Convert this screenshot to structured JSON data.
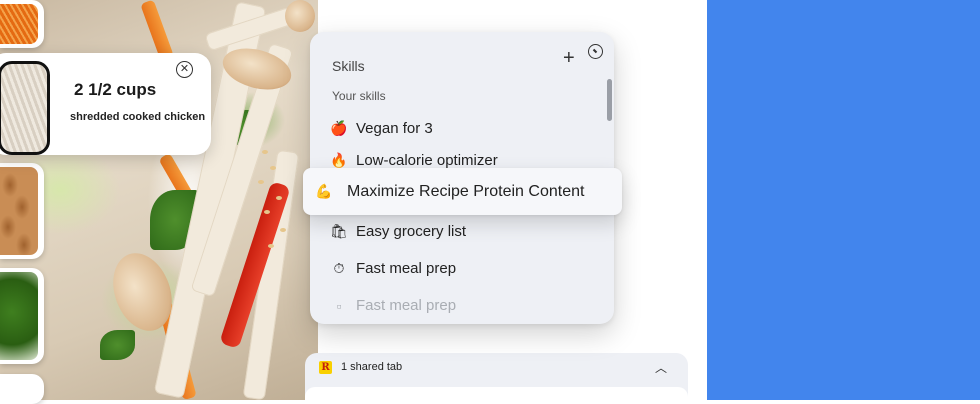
{
  "ingredient_card": {
    "quantity": "2 1/2 cups",
    "description": "shredded cooked chicken"
  },
  "skills_panel": {
    "title": "Skills",
    "section_label": "Your skills",
    "items": [
      {
        "icon": "apple-emoji",
        "glyph": "🍎",
        "label": "Vegan for 3"
      },
      {
        "icon": "fire-emoji",
        "glyph": "🔥",
        "label": "Low-calorie optimizer"
      },
      {
        "icon": "flexed-biceps-emoji",
        "glyph": "💪",
        "label": "Maximize Recipe Protein Content"
      },
      {
        "icon": "shopping-bags-emoji",
        "glyph": "🛍",
        "label": "Easy grocery list"
      },
      {
        "icon": "stopwatch-emoji",
        "glyph": "⏱",
        "label": "Fast meal prep"
      },
      {
        "icon": "page-icon",
        "glyph": "▫",
        "label": "Fast meal prep"
      }
    ]
  },
  "shared_tab": {
    "icon_letter": "R",
    "label": "1 shared tab"
  },
  "colors": {
    "blue_band": "#4285ed",
    "panel_bg": "#eef0f5"
  }
}
